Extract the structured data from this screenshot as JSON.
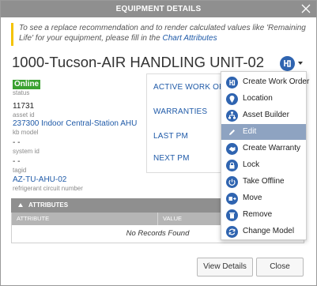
{
  "dialog": {
    "title": "EQUIPMENT DETAILS",
    "notice_text": "To see a replace recommendation and to render calculated values like 'Remaining Life' for your equipment, please fill in the",
    "notice_link": "Chart Attributes",
    "equipment_name": "1000-Tucson-AIR HANDLING UNIT-02"
  },
  "fields": [
    {
      "value": "Online",
      "label": "status"
    },
    {
      "value": "11731",
      "label": "asset id"
    },
    {
      "value": "237300 Indoor Central-Station AHU",
      "label": "kb model"
    },
    {
      "value": "- -",
      "label": "system id"
    },
    {
      "value": "- -",
      "label": "tagid"
    },
    {
      "value": "AZ-TU-AHU-02",
      "label": "refrigerant circuit number"
    }
  ],
  "right_links": [
    "ACTIVE WORK ORDERS",
    "WARRANTIES",
    "LAST PM",
    "NEXT PM"
  ],
  "attributes": {
    "header": "ATTRIBUTES",
    "col_attribute": "ATTRIBUTE",
    "col_value": "VALUE",
    "empty_text": "No Records Found"
  },
  "buttons": {
    "view_details": "View Details",
    "close": "Close"
  },
  "menu": {
    "items": [
      {
        "label": "Create Work Order",
        "icon": "wrench-icon"
      },
      {
        "label": "Location",
        "icon": "location-pin-icon"
      },
      {
        "label": "Asset Builder",
        "icon": "hierarchy-icon"
      },
      {
        "label": "Edit",
        "icon": "pencil-icon"
      },
      {
        "label": "Create Warranty",
        "icon": "warranty-icon"
      },
      {
        "label": "Lock",
        "icon": "lock-icon"
      },
      {
        "label": "Take Offline",
        "icon": "power-icon"
      },
      {
        "label": "Move",
        "icon": "move-icon"
      },
      {
        "label": "Remove",
        "icon": "trash-icon"
      },
      {
        "label": "Change Model",
        "icon": "refresh-icon"
      }
    ],
    "active_item": "Edit"
  },
  "colors": {
    "accent_blue": "#2f64b0",
    "status_green": "#3aa130",
    "notice_bar": "#f4c300",
    "titlebar": "#8f8f8f"
  }
}
